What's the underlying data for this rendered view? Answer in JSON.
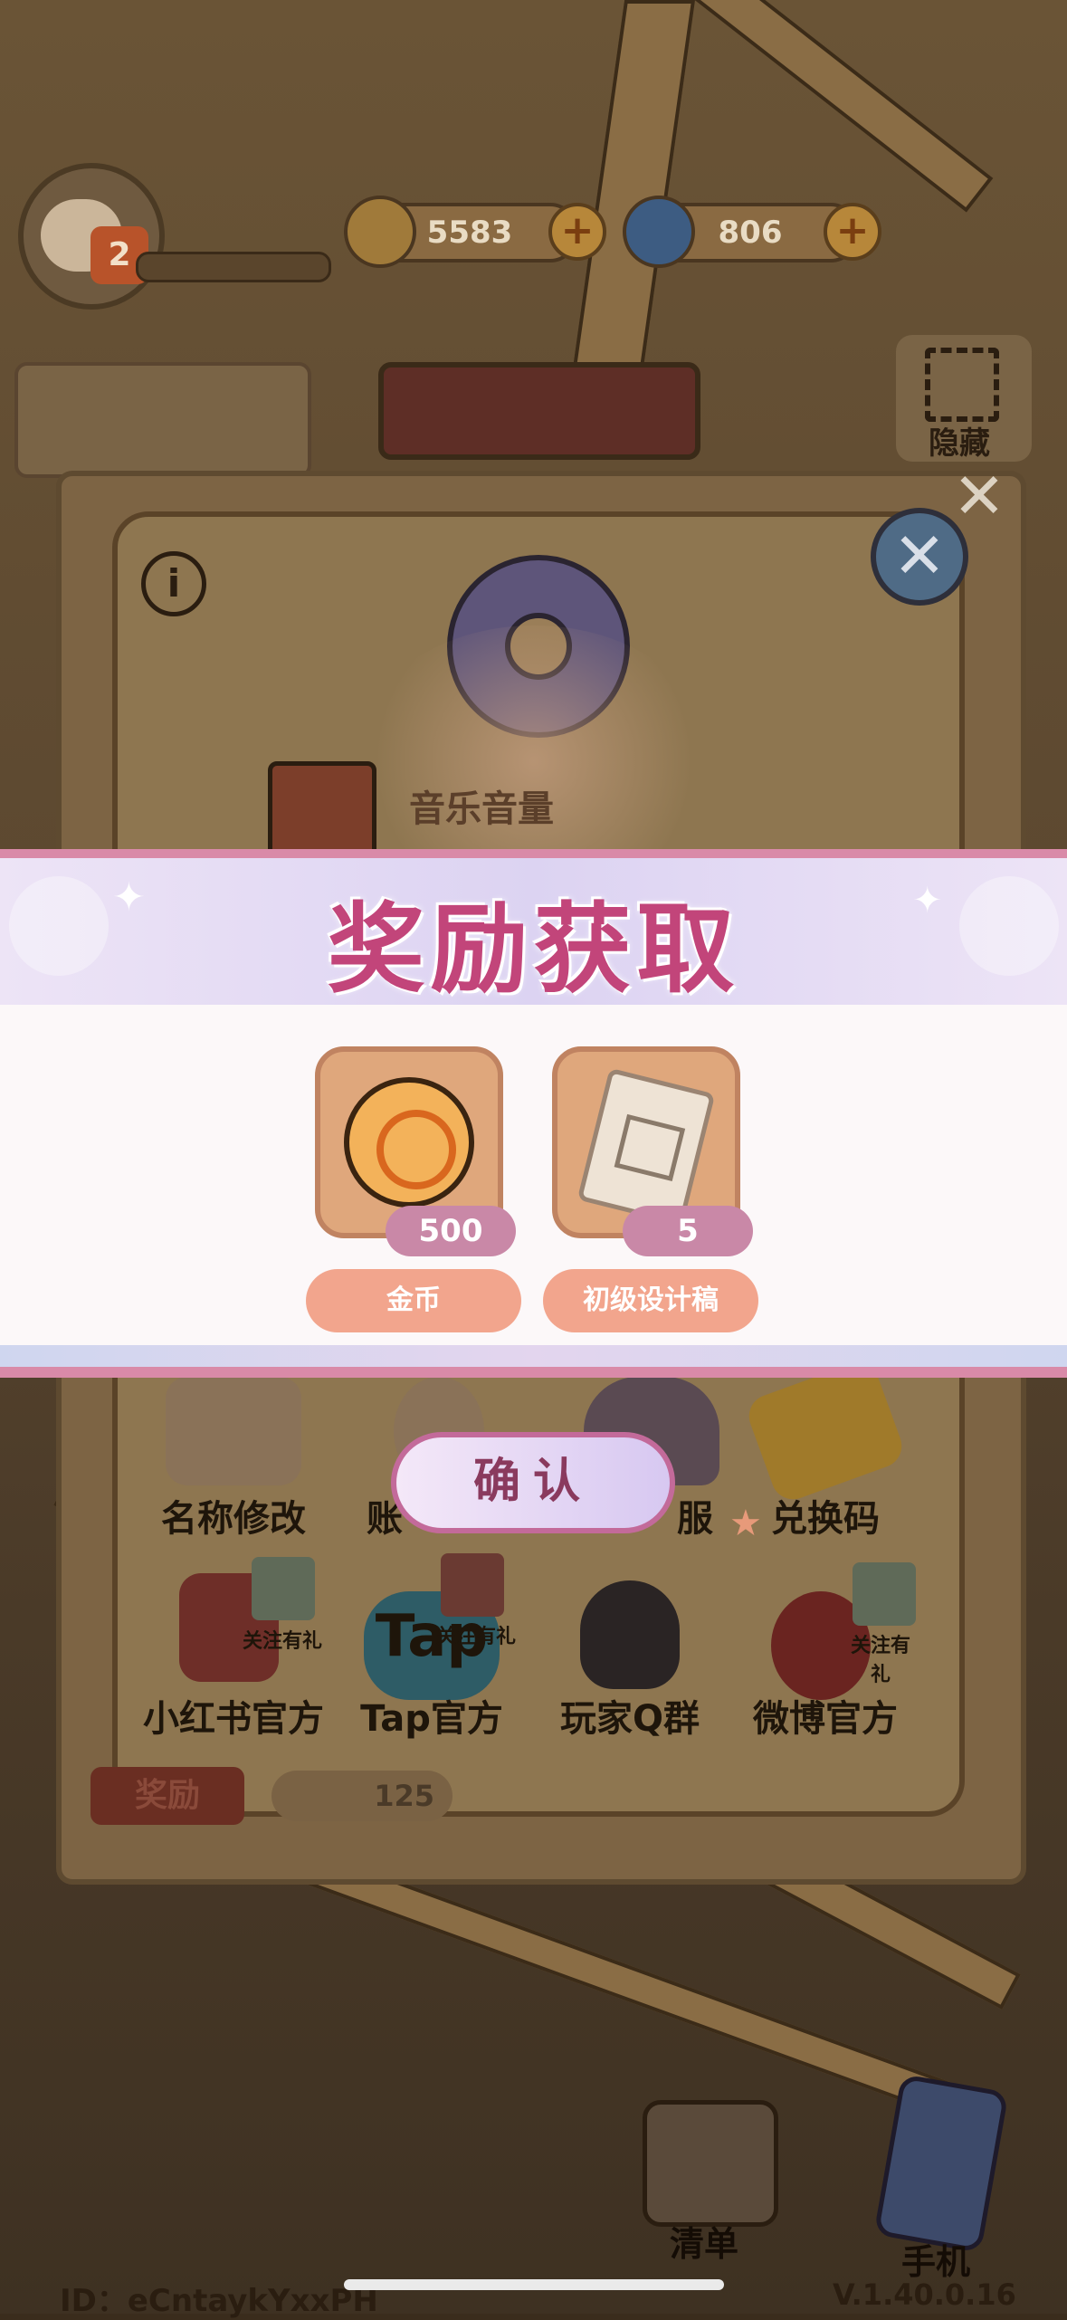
{
  "hud": {
    "level": "2",
    "coins": "5583",
    "gems": "806",
    "hide_label": "隐藏"
  },
  "settings": {
    "music_volume_label": "音乐音量",
    "options_row1": [
      "名称修改",
      "账",
      "服",
      "兑换码"
    ],
    "options_row2": [
      "小红书官方",
      "Tap官方",
      "玩家Q群",
      "微博官方"
    ],
    "follow_gift": "关注有礼",
    "tap_logo": "Tap",
    "hidden_footer": "奖励",
    "hidden_footer_count": "125"
  },
  "reward_popup": {
    "title": "奖励获取",
    "items": [
      {
        "name": "金币",
        "count": "500"
      },
      {
        "name": "初级设计稿",
        "count": "5"
      }
    ],
    "confirm_label": "确认"
  },
  "bottom": {
    "list_label": "清单",
    "phone_label": "手机",
    "player_id": "ID：eCntaykYxxPH",
    "version": "V.1.40.0.16"
  },
  "colors": {
    "title_pink": "#c2457a",
    "banner_border": "#d98aa8",
    "reward_name_bg": "#f2a58d",
    "count_badge_bg": "#c988a7"
  }
}
